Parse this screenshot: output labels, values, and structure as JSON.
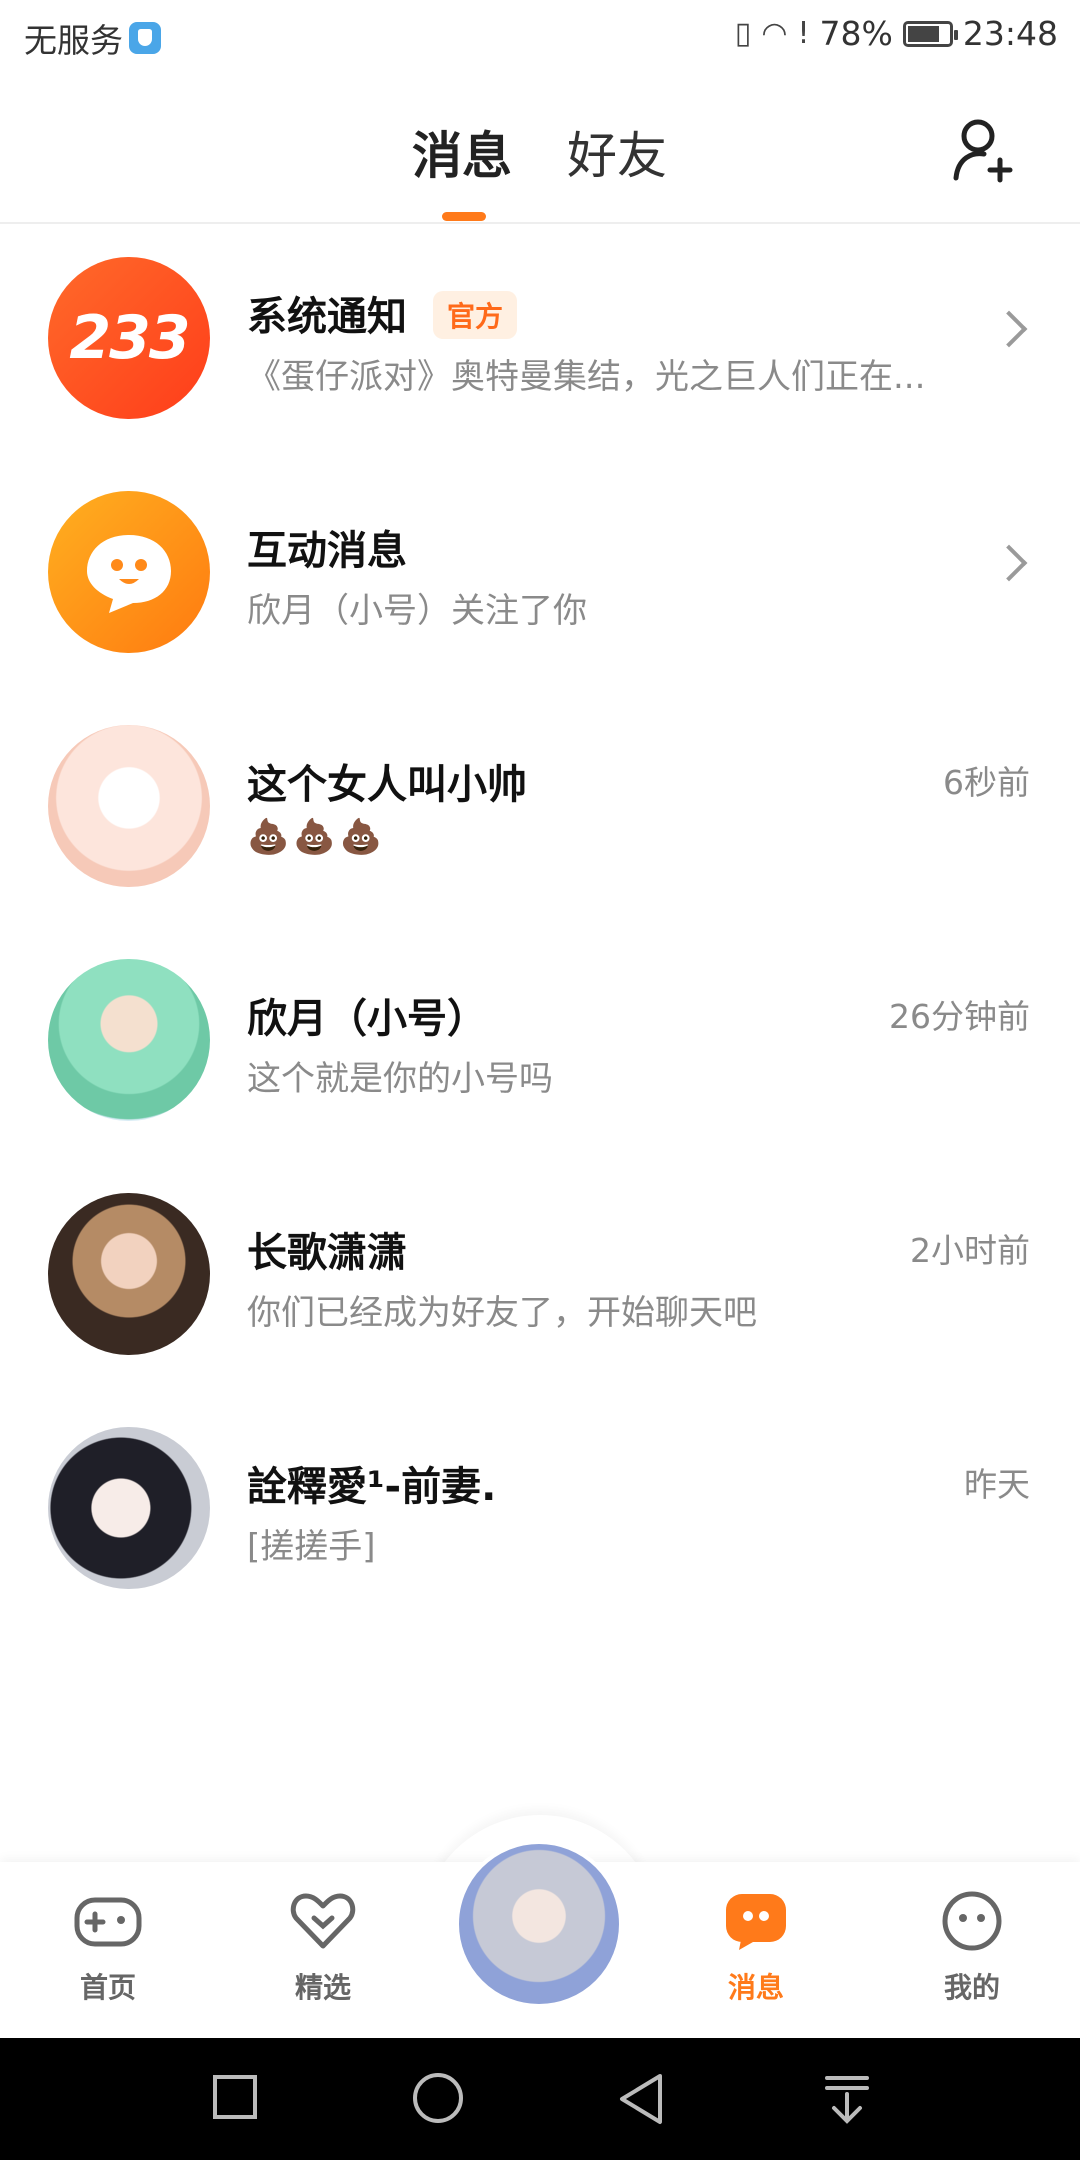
{
  "status_bar": {
    "carrier": "无服务",
    "battery": "78%",
    "battery_level": 0.78,
    "time": "23:48",
    "icons": [
      "shield-icon",
      "vibrate-icon",
      "wifi-icon",
      "alert-icon",
      "battery-icon"
    ]
  },
  "header": {
    "tabs": [
      {
        "label": "消息",
        "active": true
      },
      {
        "label": "好友",
        "active": false
      }
    ],
    "add_friend_icon": "add-friend-icon"
  },
  "conversations": [
    {
      "name": "系统通知",
      "badge": "官方",
      "preview": "《蛋仔派对》奥特曼集结，光之巨人们正在...",
      "time": "",
      "avatar_text": "233",
      "chevron": true
    },
    {
      "name": "互动消息",
      "badge": "",
      "preview": "欣月（小号）关注了你",
      "time": "",
      "avatar_text": "",
      "chevron": true
    },
    {
      "name": "这个女人叫小帅",
      "badge": "",
      "preview": "💩💩💩",
      "time": "6秒前",
      "avatar_text": "",
      "chevron": false
    },
    {
      "name": "欣月（小号）",
      "badge": "",
      "preview": "这个就是你的小号吗",
      "time": "26分钟前",
      "avatar_text": "",
      "chevron": false
    },
    {
      "name": "长歌潇潇",
      "badge": "",
      "preview": "你们已经成为好友了，开始聊天吧",
      "time": "2小时前",
      "avatar_text": "",
      "chevron": false
    },
    {
      "name": "詮釋愛¹-前妻.",
      "badge": "",
      "preview": "[搓搓手]",
      "time": "昨天",
      "avatar_text": "",
      "chevron": false
    }
  ],
  "bottom_nav": [
    {
      "label": "首页",
      "icon": "gamepad-icon",
      "active": false
    },
    {
      "label": "精选",
      "icon": "heart-icon",
      "active": false
    },
    {
      "label": "消息",
      "icon": "message-icon",
      "active": true
    },
    {
      "label": "我的",
      "icon": "face-icon",
      "active": false
    }
  ],
  "colors": {
    "accent": "#ff7a1a",
    "muted": "#8a8a8a"
  }
}
